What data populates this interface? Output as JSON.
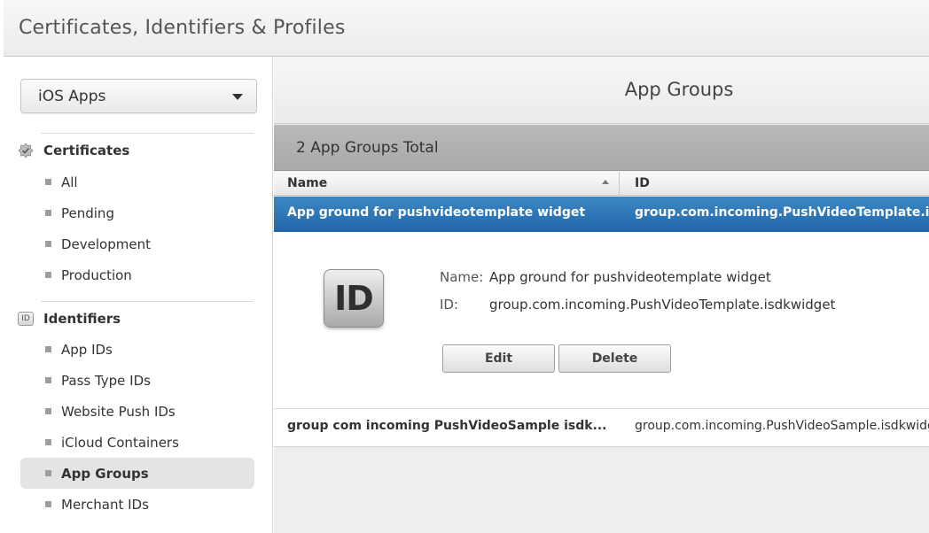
{
  "header": {
    "title": "Certificates, Identifiers & Profiles"
  },
  "sidebar": {
    "platform_select": {
      "value": "iOS Apps"
    },
    "certificates": {
      "heading": "Certificates",
      "items": [
        "All",
        "Pending",
        "Development",
        "Production"
      ]
    },
    "identifiers": {
      "heading": "Identifiers",
      "badge": "ID",
      "items": [
        "App IDs",
        "Pass Type IDs",
        "Website Push IDs",
        "iCloud Containers",
        "App Groups",
        "Merchant IDs"
      ],
      "active": "App Groups"
    }
  },
  "main": {
    "page_title": "App Groups",
    "total_label": "2 App Groups Total",
    "columns": {
      "name": "Name",
      "id": "ID"
    },
    "rows": [
      {
        "name": "App ground for pushvideotemplate widget",
        "id": "group.com.incoming.PushVideoTemplate.isdkwidget",
        "selected": true
      },
      {
        "name": "group com incoming PushVideoSample isdk...",
        "id": "group.com.incoming.PushVideoSample.isdkwidget",
        "selected": false
      }
    ],
    "detail": {
      "icon_text": "ID",
      "name_label": "Name:",
      "name_value": "App ground for pushvideotemplate widget",
      "id_label": "ID:",
      "id_value": "group.com.incoming.PushVideoTemplate.isdkwidget",
      "edit_label": "Edit",
      "delete_label": "Delete"
    }
  },
  "colors": {
    "selection": "#2a72b5",
    "totals_bar": "#b0b0b0",
    "active_nav": "#e4e4e4"
  }
}
